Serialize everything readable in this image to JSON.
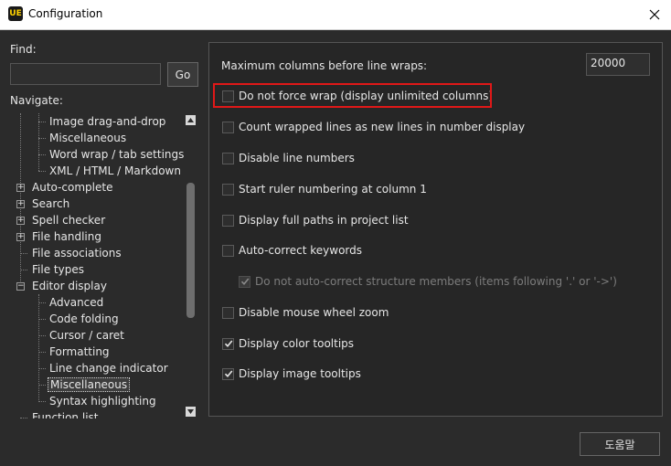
{
  "window": {
    "title": "Configuration",
    "icon_label": "UE"
  },
  "find": {
    "label": "Find:",
    "value": "",
    "go_label": "Go"
  },
  "navigate": {
    "label": "Navigate:",
    "tree": [
      {
        "label": "Image drag-and-drop",
        "level": 1
      },
      {
        "label": "Miscellaneous",
        "level": 1
      },
      {
        "label": "Word wrap / tab settings",
        "level": 1
      },
      {
        "label": "XML / HTML / Markdown",
        "level": 1
      },
      {
        "label": "Auto-complete",
        "level": 0,
        "expander": "+"
      },
      {
        "label": "Search",
        "level": 0,
        "expander": "+"
      },
      {
        "label": "Spell checker",
        "level": 0,
        "expander": "+"
      },
      {
        "label": "File handling",
        "level": 0,
        "expander": "+"
      },
      {
        "label": "File associations",
        "level": 0
      },
      {
        "label": "File types",
        "level": 0
      },
      {
        "label": "Editor display",
        "level": 0,
        "expander": "−"
      },
      {
        "label": "Advanced",
        "level": 1
      },
      {
        "label": "Code folding",
        "level": 1
      },
      {
        "label": "Cursor / caret",
        "level": 1
      },
      {
        "label": "Formatting",
        "level": 1
      },
      {
        "label": "Line change indicator",
        "level": 1
      },
      {
        "label": "Miscellaneous",
        "level": 1,
        "selected": true
      },
      {
        "label": "Syntax highlighting",
        "level": 1
      },
      {
        "label": "Function list",
        "level": 0
      }
    ]
  },
  "settings": {
    "max_columns_label": "Maximum columns before line wraps:",
    "max_columns_value": "20000",
    "options": [
      {
        "label": "Do not force wrap (display unlimited columns)",
        "checked": false
      },
      {
        "label": "Count wrapped lines as new lines in number display",
        "checked": false
      },
      {
        "label": "Disable line numbers",
        "checked": false
      },
      {
        "label": "Start ruler numbering at column 1",
        "checked": false
      },
      {
        "label": "Display full paths in project list",
        "checked": false
      },
      {
        "label": "Auto-correct keywords",
        "checked": false
      },
      {
        "label": "Do not auto-correct structure members (items following '.' or '->')",
        "checked": true,
        "disabled": true
      },
      {
        "label": "Disable mouse wheel zoom",
        "checked": false
      },
      {
        "label": "Display color tooltips",
        "checked": true
      },
      {
        "label": "Display image tooltips",
        "checked": true
      }
    ]
  },
  "footer": {
    "help_label": "도움말"
  },
  "colors": {
    "highlight": "#e01818",
    "background": "#2b2b2b",
    "panel": "#262626"
  }
}
